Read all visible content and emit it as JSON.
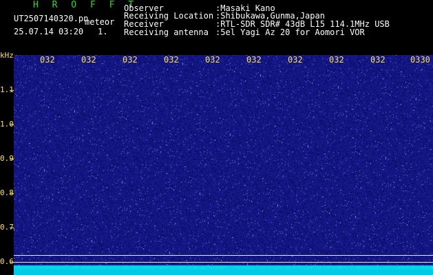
{
  "header": {
    "brand": "H R O F F T",
    "filename": "UT2507140320.pn",
    "mode": "meteor",
    "datetime": "25.07.14 03:20",
    "index": "1.",
    "labels": {
      "observer": "Observer",
      "location": "Receiving Location",
      "receiver": "Receiver",
      "antenna": "Receiving antenna"
    },
    "values": {
      "observer": ":Masaki Kano",
      "location": ":Shibukawa,Gunma,Japan",
      "receiver": ":RTL-SDR SDR# 43dB L15 114.1MHz USB",
      "antenna": ":5el Yagi Az 20 for Aomori VOR"
    }
  },
  "axes": {
    "y_unit": "kHz",
    "x_ticks": [
      "032",
      "032",
      "032",
      "032",
      "032",
      "032",
      "032",
      "032",
      "032",
      "0330"
    ],
    "y_ticks": [
      "1.1",
      "1.0",
      "0.9",
      "0.8",
      "0.7",
      "0.6"
    ]
  },
  "colors": {
    "background": "#000000",
    "plot": "#14147e",
    "tick_text": "#ffe14a",
    "brand": "#22dd22",
    "band": "#00c8e8",
    "reference_line": "#e9e9f2"
  }
}
